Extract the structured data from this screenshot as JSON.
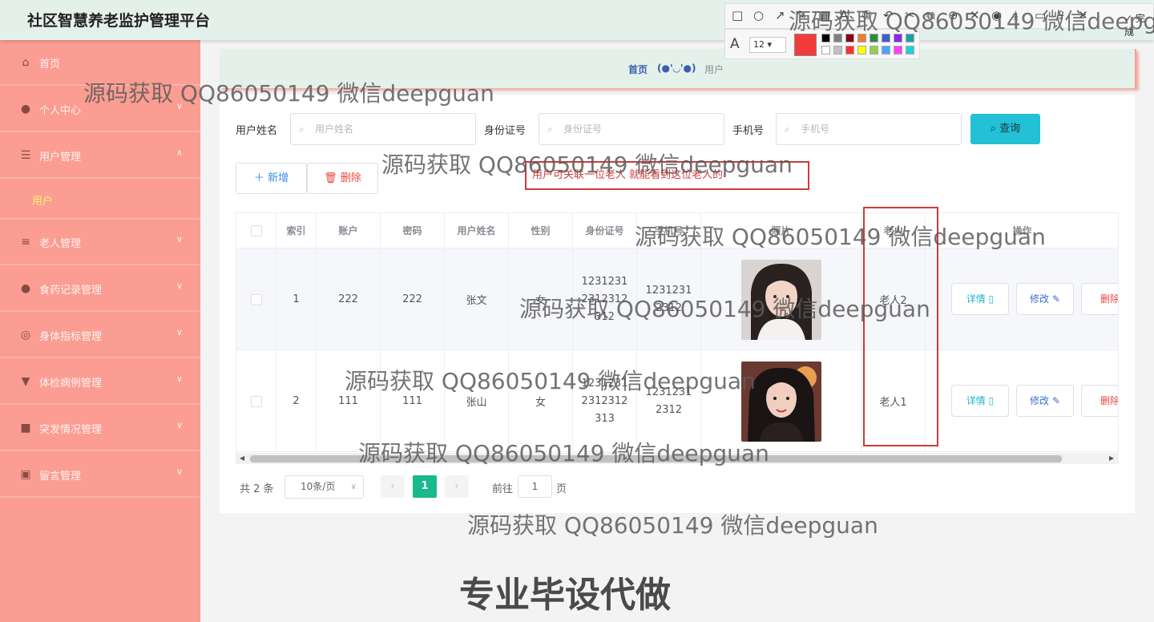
{
  "app": {
    "title": "社区智慧养老监护管理平台"
  },
  "sidebar": {
    "items": [
      {
        "label": "首页",
        "icon": "home-icon"
      },
      {
        "label": "个人中心",
        "icon": "user-icon"
      },
      {
        "label": "用户管理",
        "icon": "sliders-icon"
      },
      {
        "label": "用户",
        "sub": true
      },
      {
        "label": "老人管理",
        "icon": "list-icon"
      },
      {
        "label": "食药记录管理",
        "icon": "user-icon"
      },
      {
        "label": "身体指标管理",
        "icon": "target-icon"
      },
      {
        "label": "体检病例管理",
        "icon": "stamp-icon"
      },
      {
        "label": "突发情况管理",
        "icon": "briefcase-icon"
      },
      {
        "label": "留言管理",
        "icon": "clipboard-icon"
      }
    ]
  },
  "breadcrumb": {
    "home": "首页",
    "face": "(●'◡'●)",
    "current": "用户"
  },
  "search": {
    "name_label": "用户姓名",
    "name_placeholder": "用户姓名",
    "id_label": "身份证号",
    "id_placeholder": "身份证号",
    "phone_label": "手机号",
    "phone_placeholder": "手机号",
    "query_label": "查询"
  },
  "toolbar": {
    "add_label": "新增",
    "delete_label": "删除"
  },
  "annotation_text": "用户可关联一位老人 就能看到这位老人的",
  "table": {
    "columns": [
      "索引",
      "账户",
      "密码",
      "用户姓名",
      "性别",
      "身份证号",
      "手机号",
      "照片",
      "老人",
      "操作"
    ],
    "rows": [
      {
        "index": "1",
        "account": "222",
        "password": "222",
        "name": "张文",
        "gender": "女",
        "id_number": "12312312312312312",
        "phone": "12312312312",
        "elder": "老人2"
      },
      {
        "index": "2",
        "account": "111",
        "password": "111",
        "name": "张山",
        "gender": "女",
        "id_number": "12312312312312313",
        "phone": "12312312312",
        "elder": "老人1"
      }
    ],
    "actions": {
      "detail": "详情",
      "edit": "修改",
      "delete": "删除"
    }
  },
  "pagination": {
    "total": "共 2 条",
    "page_size": "10条/页",
    "current_page": "1",
    "goto_prefix": "前往",
    "goto_value": "1",
    "goto_suffix": "页"
  },
  "snap_tool": {
    "done_label": "完成",
    "font_size": "12",
    "current_color": "#f23c3c"
  },
  "watermarks": {
    "text": "源码获取 QQ86050149 微信deepguan",
    "footer": "专业毕设代做"
  },
  "colors": {
    "sidebar": "#fb9d92",
    "header": "#e4f1ea",
    "accent": "#22c1d6",
    "active_page": "#19b98c",
    "highlight": "#d03a3a"
  }
}
